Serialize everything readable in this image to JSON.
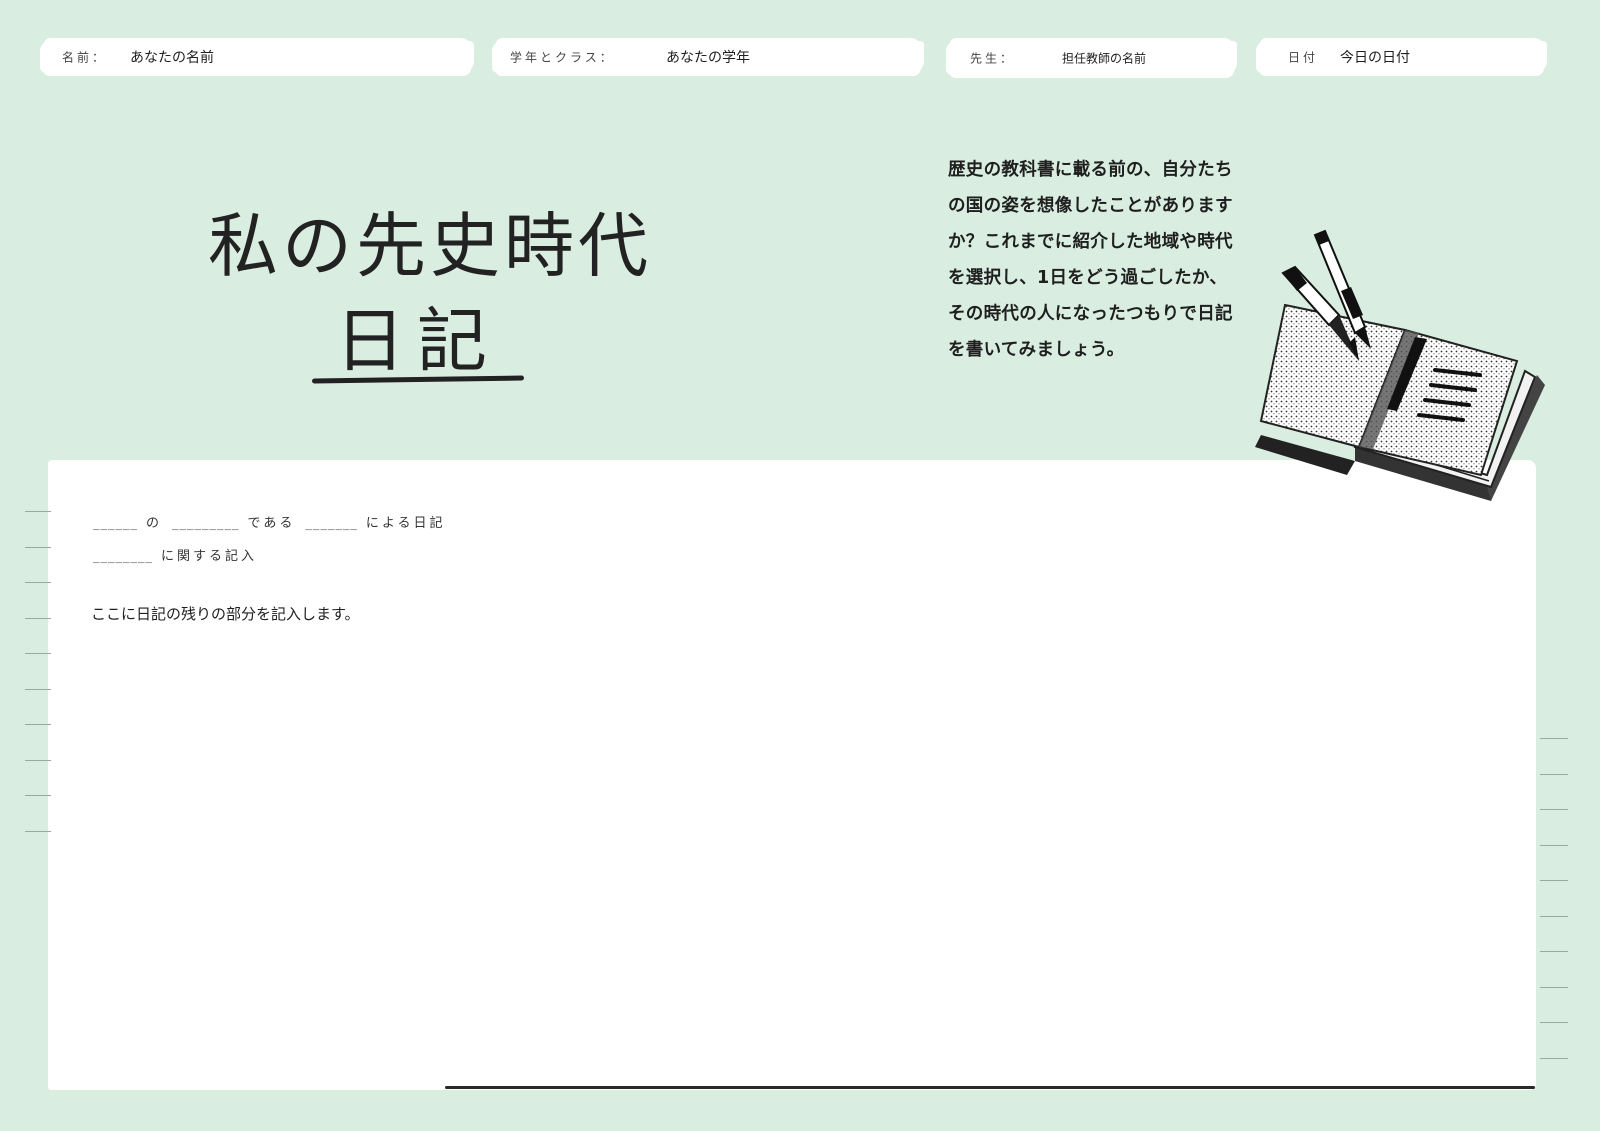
{
  "header_fields": {
    "name": {
      "label": "名前：",
      "value": "あなたの名前"
    },
    "grade": {
      "label": "学年とクラス：",
      "value": "あなたの学年"
    },
    "teacher": {
      "label": "先生：",
      "value": "担任教師の名前"
    },
    "date": {
      "label": "日付",
      "value": "今日の日付"
    }
  },
  "title": {
    "line1": "私の先史時代",
    "line2": "日記"
  },
  "description": "歴史の教科書に載る前の、自分たちの国の姿を想像したことがありますか？これまでに紹介した地域や時代を選択し、1日をどう過ごしたか、その時代の人になったつもりで日記を書いてみましょう。",
  "entry": {
    "line1": {
      "blank1": "______",
      "word1": "の",
      "blank2": "_________",
      "word2": "である",
      "blank3": "_______",
      "word3": "による日記"
    },
    "line2": {
      "blank1": "________",
      "word1": "に関する記入"
    },
    "body": "ここに日記の残りの部分を記入します。"
  },
  "illustration": {
    "icon": "open-book-with-pencils-icon"
  },
  "colors": {
    "background": "#d9ede1",
    "paper": "#ffffff",
    "ink": "#1f1f1f"
  }
}
